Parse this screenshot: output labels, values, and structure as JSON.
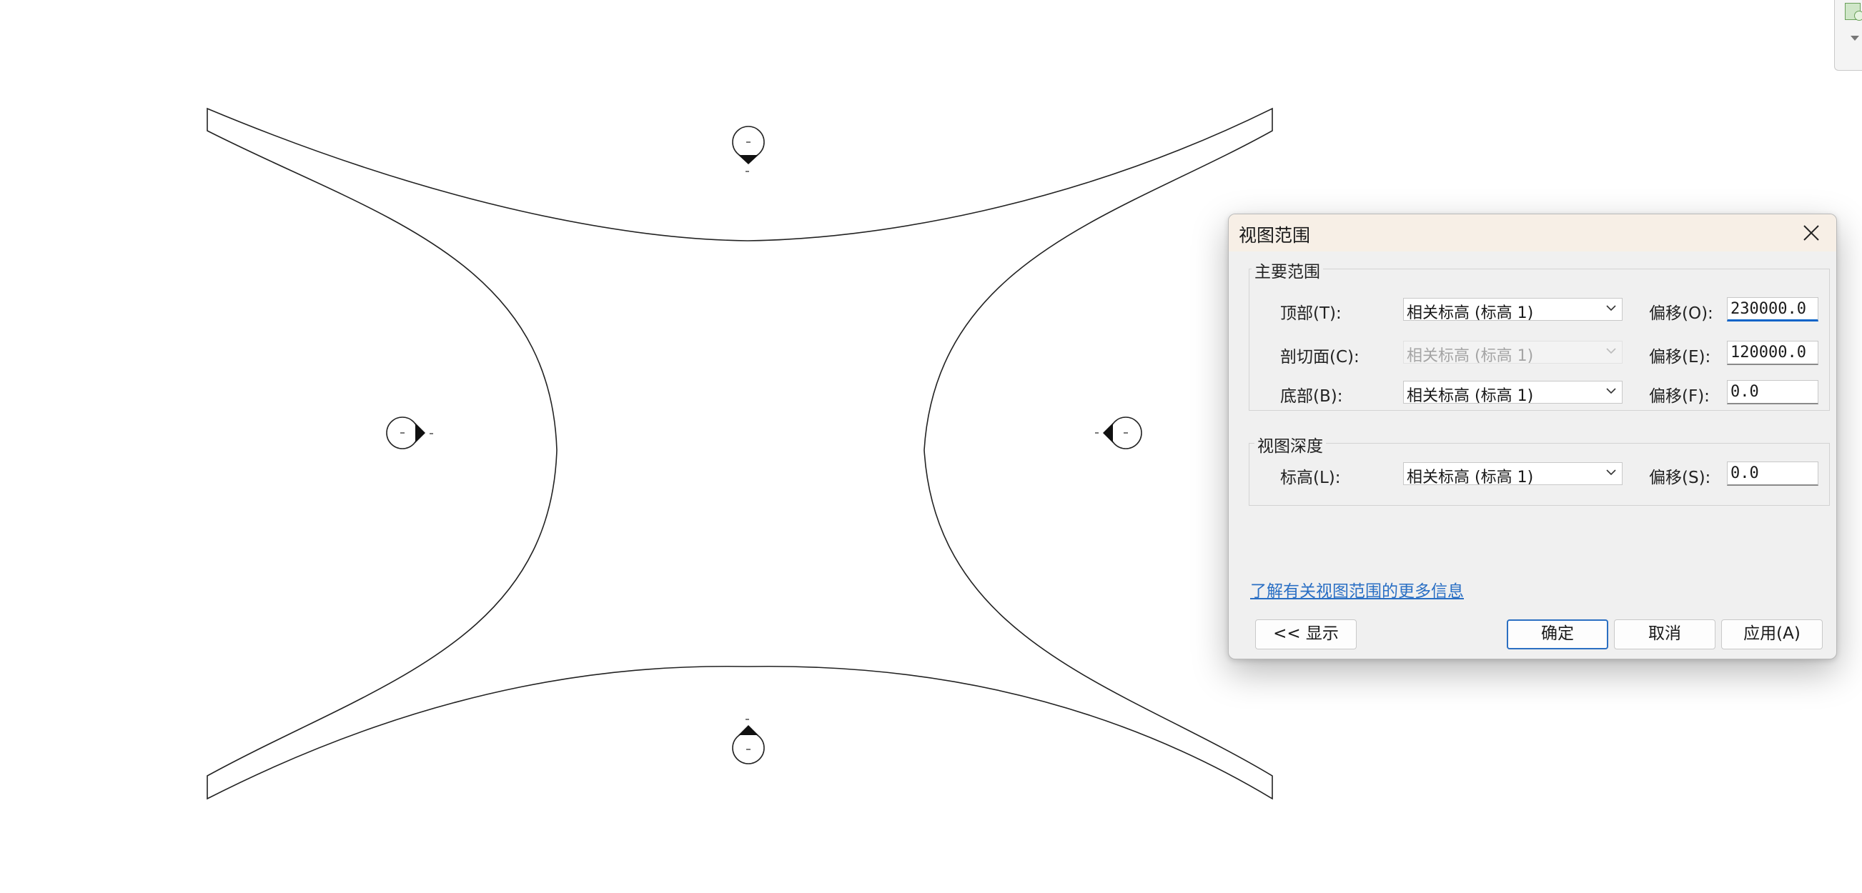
{
  "dialog": {
    "title": "视图范围",
    "primary_range": {
      "title": "主要范围",
      "top": {
        "label": "顶部(T):",
        "combo_value": "相关标高 (标高 1)",
        "offset_label": "偏移(O):",
        "offset_value": "230000.0"
      },
      "cut_plane": {
        "label": "剖切面(C):",
        "combo_value": "相关标高 (标高 1)",
        "offset_label": "偏移(E):",
        "offset_value": "120000.0"
      },
      "bottom": {
        "label": "底部(B):",
        "combo_value": "相关标高 (标高 1)",
        "offset_label": "偏移(F):",
        "offset_value": "0.0"
      }
    },
    "view_depth": {
      "title": "视图深度",
      "level": {
        "label": "标高(L):",
        "combo_value": "相关标高 (标高 1)",
        "offset_label": "偏移(S):",
        "offset_value": "0.0"
      }
    },
    "help_link": "了解有关视图范围的更多信息",
    "buttons": {
      "show": "<< 显示",
      "ok": "确定",
      "cancel": "取消",
      "apply": "应用(A)"
    }
  },
  "drawing": {
    "elevation_markers": [
      "north",
      "west",
      "east",
      "south"
    ]
  }
}
